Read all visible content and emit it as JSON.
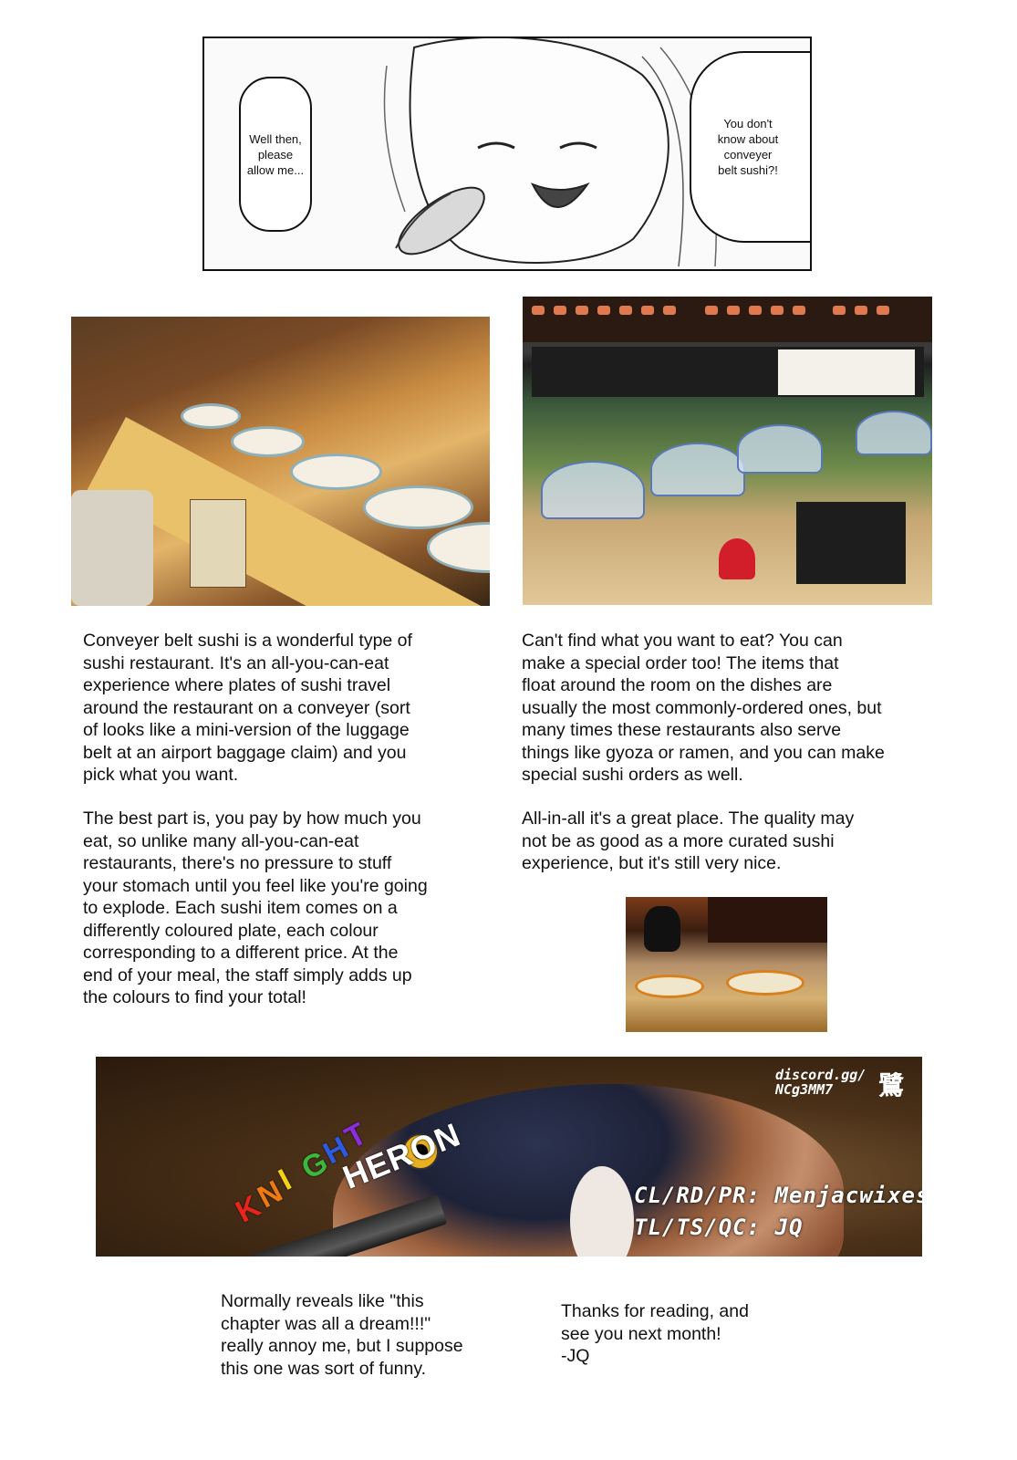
{
  "manga_panel": {
    "bubble_left": "Well then,\nplease\nallow me...",
    "bubble_right": "You don't\nknow about\nconveyer\nbelt sushi?!"
  },
  "left_column": {
    "paragraph_1": "Conveyer belt sushi is a wonderful type of\nsushi restaurant. It's an all-you-can-eat\nexperience where plates of sushi travel\naround the restaurant on a conveyer (sort\nof looks like a mini-version of the luggage\nbelt at an airport baggage claim) and you\npick what you want.",
    "paragraph_2": "The best part is, you pay by how much you\neat, so unlike many all-you-can-eat\nrestaurants, there's no pressure to stuff\nyour stomach until you feel like you're going\nto explode. Each sushi item comes on a\ndifferently coloured plate, each colour\ncorresponding to a different price. At the\nend of your meal, the staff simply adds up\nthe colours to find your total!"
  },
  "right_column": {
    "paragraph_1": "Can't find what you want to eat? You can\nmake a special order too! The items that\nfloat around the room on the dishes are\nusually the most commonly-ordered ones, but\nmany times these restaurants also serve\nthings like gyoza or ramen, and you can make\nspecial sushi orders as well.",
    "paragraph_2": "All-in-all it's a great place. The quality may\nnot be as good as a more curated sushi\nexperience, but it's still very nice."
  },
  "credits_banner": {
    "discord": "discord.gg/\nNCg3MM7",
    "kanji": "鷺",
    "logo_knight": [
      "K",
      "N",
      "I",
      "G",
      "H",
      "T"
    ],
    "logo_knight_colors": [
      "#e8251c",
      "#f07a12",
      "#f4d21a",
      "#3cb83c",
      "#2c5ae0",
      "#8a2ce0"
    ],
    "logo_heron": "HERON",
    "credit_line_1": "CL/RD/PR: Menjacwixes",
    "credit_line_2": "TL/TS/QC: JQ"
  },
  "footer": {
    "note_left": "Normally reveals like \"this\nchapter was all a dream!!!\"\nreally annoy me, but I suppose\nthis one was sort of funny.",
    "note_right": "Thanks for reading, and\nsee you next month!\n-JQ"
  }
}
